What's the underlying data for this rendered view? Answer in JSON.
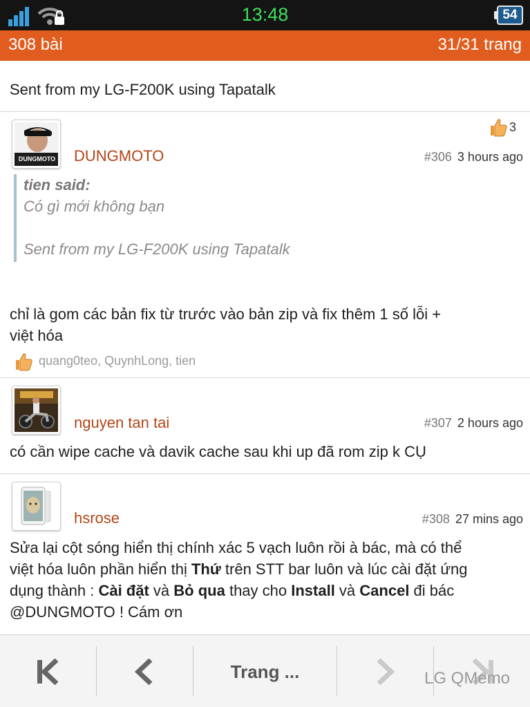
{
  "status_bar": {
    "time": "13:48",
    "battery": "54",
    "signal_icon": "signal-icon",
    "wifi_icon": "wifi-lock-icon"
  },
  "topbar": {
    "post_count": "308 bài",
    "page_indicator": "31/31 trang",
    "color": "#e15d1f"
  },
  "prev_post_tail": "Sent from my LG-F200K using Tapatalk",
  "posts": [
    {
      "username": "DUNGMOTO",
      "avatar_label": "DUNGMOTO",
      "number": "#306",
      "time": "3 hours ago",
      "like_count": "3",
      "quote": {
        "author": "tien said:",
        "line1": "Có gì mới không bạn",
        "line2": "Sent from my LG-F200K using Tapatalk"
      },
      "body_line1": "chỉ là gom các bản fix từ trước vào bản zip và fix thêm 1 số lỗi +",
      "body_line2": "việt hóa",
      "liked_by": "quang0teo, QuynhLong, tien"
    },
    {
      "username": "nguyen tan tai",
      "number": "#307",
      "time": "2 hours ago",
      "body": "có cần wipe cache và davik cache sau khi up đã rom zip k CỤ"
    },
    {
      "username": "hsrose",
      "number": "#308",
      "time": "27 mins ago",
      "body": {
        "l1": "Sửa lại cột sóng hiển thị chính xác 5 vạch luôn rồi à bác, mà có thể",
        "l2_a": "việt hóa luôn phần hiển thị ",
        "l2_b": "Thứ",
        "l2_c": " trên STT bar luôn và lúc cài đặt ứng",
        "l3_a": "dụng thành : ",
        "l3_b": "Cài đặt",
        "l3_c": " và ",
        "l3_d": "Bỏ qua",
        "l3_e": " thay cho ",
        "l3_f": "Install",
        "l3_g": " và ",
        "l3_h": "Cancel",
        "l3_i": " đi bác",
        "l4": "@DUNGMOTO ! Cám ơn"
      }
    }
  ],
  "bottom_nav": {
    "page_label": "Trang ...",
    "icons": [
      "first-page-icon",
      "prev-page-icon",
      "next-page-icon",
      "last-page-icon"
    ]
  },
  "watermark": "LG QMemo"
}
